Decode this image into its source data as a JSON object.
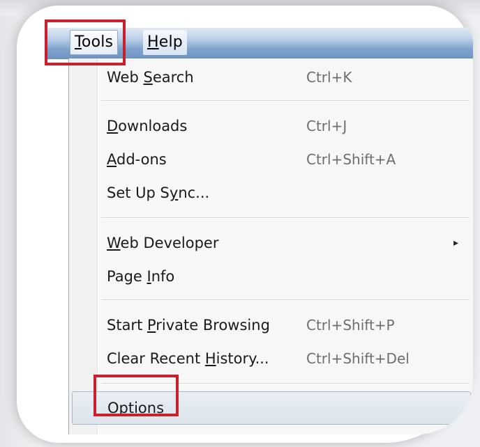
{
  "menubar": {
    "tools": {
      "prefix": "",
      "mnemonic": "T",
      "suffix": "ools"
    },
    "help": {
      "prefix": "",
      "mnemonic": "H",
      "suffix": "elp"
    }
  },
  "menu": {
    "items": [
      {
        "prefix": "Web ",
        "mnemonic": "S",
        "suffix": "earch",
        "shortcut": "Ctrl+K"
      },
      {
        "prefix": "",
        "mnemonic": "D",
        "suffix": "ownloads",
        "shortcut": "Ctrl+J"
      },
      {
        "prefix": "",
        "mnemonic": "A",
        "suffix": "dd-ons",
        "shortcut": "Ctrl+Shift+A"
      },
      {
        "prefix": "Set Up S",
        "mnemonic": "y",
        "suffix": "nc...",
        "shortcut": ""
      },
      {
        "prefix": "",
        "mnemonic": "W",
        "suffix": "eb Developer",
        "shortcut": ""
      },
      {
        "prefix": "Page ",
        "mnemonic": "I",
        "suffix": "nfo",
        "shortcut": ""
      },
      {
        "prefix": "Start ",
        "mnemonic": "P",
        "suffix": "rivate Browsing",
        "shortcut": "Ctrl+Shift+P"
      },
      {
        "prefix": "Clear Recent ",
        "mnemonic": "H",
        "suffix": "istory...",
        "shortcut": "Ctrl+Shift+Del"
      },
      {
        "prefix": "",
        "mnemonic": "O",
        "suffix": "ptions",
        "shortcut": ""
      }
    ],
    "submenu_arrow": "▸"
  },
  "colors": {
    "highlight": "#c8202c",
    "menubar_accent": "#6f95c4",
    "shortcut_text": "#6e6e6e"
  }
}
